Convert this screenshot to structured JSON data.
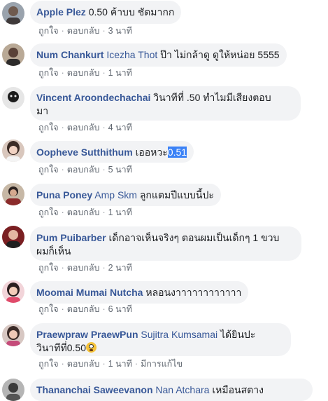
{
  "comments": [
    {
      "author": "Apple Plez",
      "tag": "",
      "text": "0.50 ค้าบบ ชัดมากก",
      "highlight": "",
      "like_label": "ถูกใจ",
      "reply_label": "ตอบกลับ",
      "time": "3 นาที",
      "edited": ""
    },
    {
      "author": "Num Chankurt",
      "tag": "Icezha Thot",
      "text": "ป๊า ไม่กล้าดู ดูให้หน่อย 5555",
      "highlight": "",
      "like_label": "ถูกใจ",
      "reply_label": "ตอบกลับ",
      "time": "1 นาที",
      "edited": ""
    },
    {
      "author": "Vincent Aroondechachai",
      "tag": "",
      "text": "วินาทีที่ .50 ทำไมมีเสียงตอบ",
      "text2": "มา",
      "highlight": "",
      "like_label": "ถูกใจ",
      "reply_label": "ตอบกลับ",
      "time": "4 นาที",
      "edited": ""
    },
    {
      "author": "Oopheve Sutthithum",
      "tag": "",
      "text": "เออหวะ",
      "highlight": "0.51",
      "like_label": "ถูกใจ",
      "reply_label": "ตอบกลับ",
      "time": "5 นาที",
      "edited": ""
    },
    {
      "author": "Puna Poney",
      "tag": "Amp Skm",
      "text": "ลูกแตมปีแบบนี้ปะ",
      "highlight": "",
      "like_label": "ถูกใจ",
      "reply_label": "ตอบกลับ",
      "time": "1 นาที",
      "edited": ""
    },
    {
      "author": "Pum Puibarber",
      "tag": "",
      "text": "เด็กอาจเห็นจริงๆ ตอนผมเป็นเด็กๆ 1 ขวบ",
      "text2": "ผมก็เห็น",
      "highlight": "",
      "like_label": "ถูกใจ",
      "reply_label": "ตอบกลับ",
      "time": "2 นาที",
      "edited": ""
    },
    {
      "author": "Moomai Mumai Nutcha",
      "tag": "",
      "text": "หลอนงาาาาาาาาาาาา",
      "highlight": "",
      "like_label": "ถูกใจ",
      "reply_label": "ตอบกลับ",
      "time": "6 นาที",
      "edited": ""
    },
    {
      "author": "Praewpraw PraewPun",
      "tag": "Sujitra Kumsamai",
      "text": "ได้ยินปะ",
      "text2": "วินาทีที่0.50",
      "highlight": "",
      "like_label": "ถูกใจ",
      "reply_label": "ตอบกลับ",
      "time": "1 นาที",
      "edited": "มีการแก้ไข"
    },
    {
      "author": "Thananchai Saweevanon",
      "tag": "Nan Atchara",
      "text": "เหมือนสตาง",
      "highlight": ""
    }
  ],
  "colors": {
    "author": "#385898",
    "bubble": "#f2f3f5",
    "meta": "#606770",
    "highlight": "#3b82f6"
  }
}
